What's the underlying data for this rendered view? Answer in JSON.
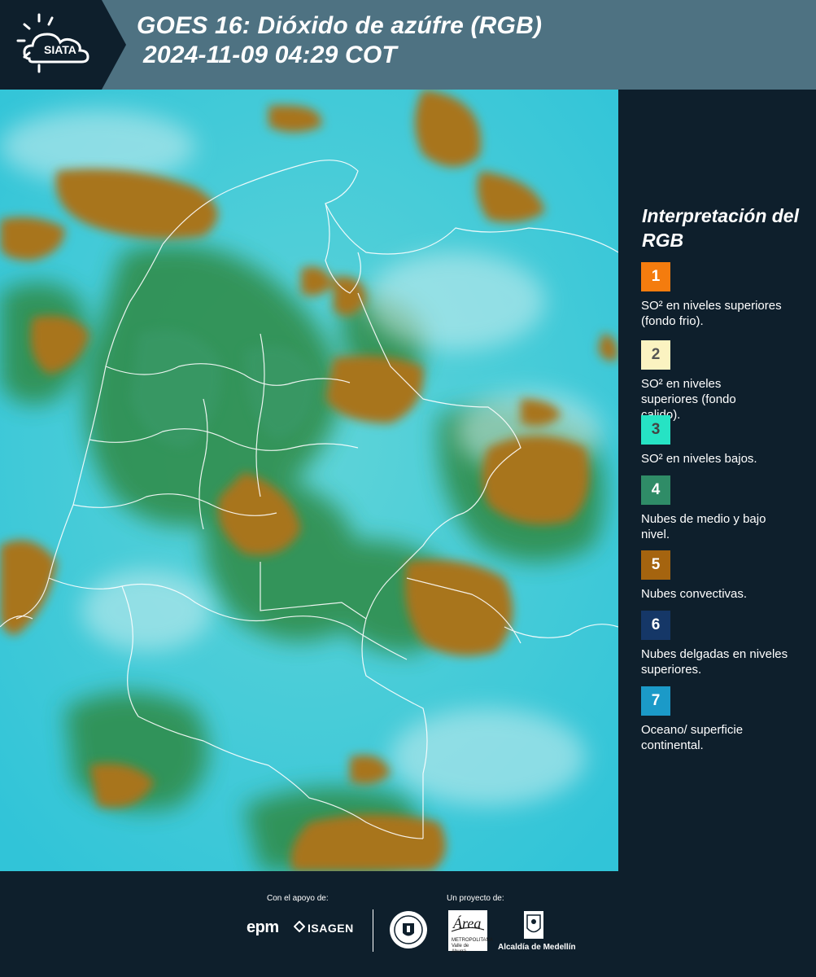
{
  "header": {
    "logo_text": "SIATA",
    "title_line1": "GOES 16: Dióxido de azúfre (RGB)",
    "title_line2": "2024-11-09 04:29 COT"
  },
  "legend": {
    "title": "Interpretación del RGB",
    "items": [
      {
        "number": "1",
        "label": "SO² en niveles superiores (fondo frio).",
        "color": "#f47c0e",
        "text_color": "#ffffff"
      },
      {
        "number": "2",
        "label": "SO² en niveles superiores (fondo calido).",
        "color": "#fbf3c1",
        "text_color": "#555555"
      },
      {
        "number": "3",
        "label": "SO² en niveles bajos.",
        "color": "#26e3c4",
        "text_color": "#444444"
      },
      {
        "number": "4",
        "label": "Nubes de medio y bajo nivel.",
        "color": "#2f8c67",
        "text_color": "#ffffff"
      },
      {
        "number": "5",
        "label": "Nubes convectivas.",
        "color": "#a5640f",
        "text_color": "#ffffff"
      },
      {
        "number": "6",
        "label": "Nubes delgadas en niveles superiores.",
        "color": "#153767",
        "text_color": "#ffffff"
      },
      {
        "number": "7",
        "label": "Oceano/ superficie continental.",
        "color": "#1b9ac8",
        "text_color": "#ffffff"
      }
    ]
  },
  "footer": {
    "support_label": "Con el apoyo de:",
    "project_label": "Un proyecto de:",
    "sponsor1": "epm",
    "sponsor2": "ISAGEN",
    "partner_area_name": "Área",
    "partner_area_sub": "METROPOLITANA Valle de Aburrá",
    "partner_alcaldia": "Alcaldía de Medellín"
  },
  "colors": {
    "header_bg": "#4e7282",
    "page_bg": "#0e1f2c",
    "cloud_convective": "#a8741c",
    "cloud_mid_low": "#2f8a3c",
    "ocean": "#34c7d6"
  }
}
